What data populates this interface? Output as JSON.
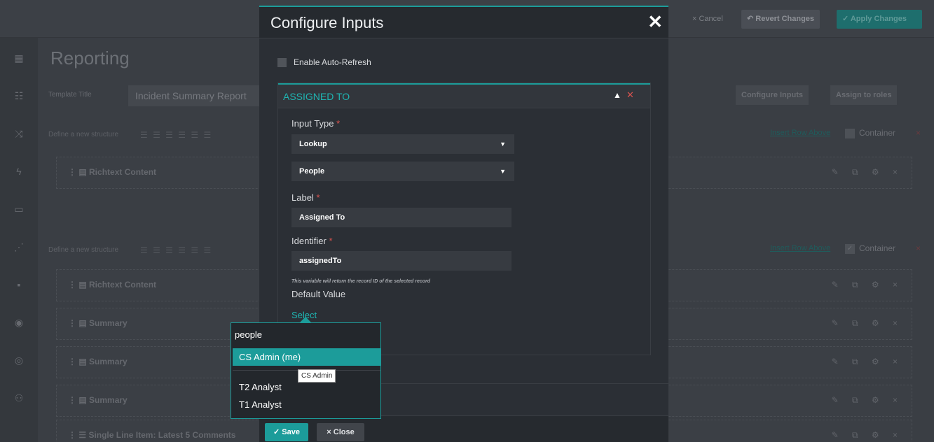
{
  "topbar": {
    "cancel_label": "× Cancel",
    "revert_label": "↶ Revert Changes",
    "apply_label": "✓ Apply Changes"
  },
  "page": {
    "title": "Reporting",
    "template_title_label": "Template Title",
    "template_title_value": "Incident Summary Report",
    "configure_inputs_label": "Configure Inputs",
    "assign_roles_label": "Assign to roles"
  },
  "structures": [
    {
      "label": "Define a new structure",
      "insert_row": "Insert Row Above",
      "container_label": "Container",
      "container_checked": false
    },
    {
      "label": "Define a new structure",
      "insert_row": "Insert Row Above",
      "container_label": "Container",
      "container_checked": true
    }
  ],
  "blocks": [
    "Richtext Content",
    "Richtext Content",
    "Summary",
    "Summary",
    "Summary",
    "Single Line Item: Latest 5 Comments"
  ],
  "modal": {
    "title": "Configure Inputs",
    "auto_refresh_label": "Enable Auto-Refresh",
    "panel": {
      "title": "ASSIGNED TO",
      "input_type_label": "Input Type",
      "input_type_value": "Lookup",
      "lookup_module": "People",
      "label_label": "Label",
      "label_value": "Assigned To",
      "identifier_label": "Identifier",
      "identifier_value": "assignedTo",
      "identifier_hint": "This variable will return the record ID of the selected record",
      "default_value_label": "Default Value",
      "select_link": "Select"
    },
    "save_label": "Save",
    "close_label": "Close"
  },
  "dropdown": {
    "search_value": "people",
    "items": [
      "CS Admin (me)",
      "T2 Analyst",
      "T1 Analyst"
    ],
    "active_index": 0,
    "tooltip": "CS Admin"
  },
  "colors": {
    "accent": "#1c9c9a",
    "danger": "#d9534f",
    "modal_bg": "#2b2f35"
  }
}
